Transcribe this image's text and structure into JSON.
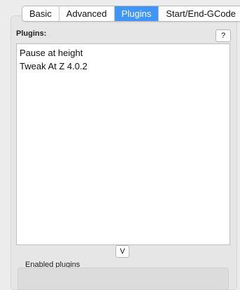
{
  "tabs": [
    {
      "label": "Basic",
      "active": false
    },
    {
      "label": "Advanced",
      "active": false
    },
    {
      "label": "Plugins",
      "active": true
    },
    {
      "label": "Start/End-GCode",
      "active": false
    }
  ],
  "plugins_section": {
    "label": "Plugins:",
    "help_label": "?",
    "items": [
      "Pause at height",
      "Tweak At Z 4.0.2"
    ]
  },
  "expand_label": "V",
  "enabled_section": {
    "label": "Enabled plugins"
  },
  "colors": {
    "accent": "#3f95f8",
    "background": "#ececec"
  }
}
